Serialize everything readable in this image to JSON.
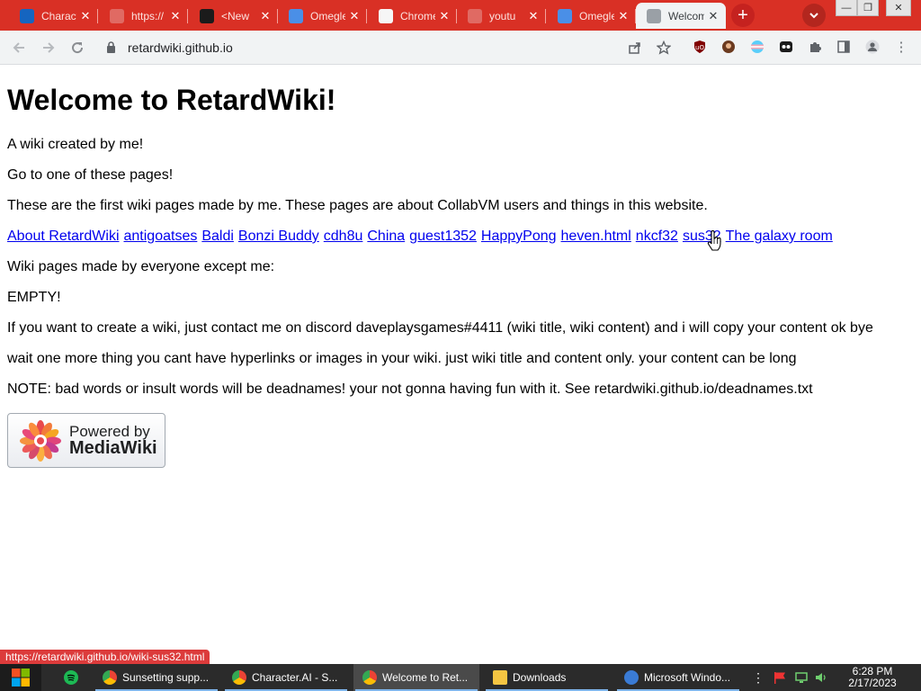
{
  "browser": {
    "tabs": [
      {
        "title": "Character.AI",
        "icon": "character-ai-icon",
        "color": "#1565c0"
      },
      {
        "title": "https://",
        "icon": "globe-icon",
        "color": "#e06a63"
      },
      {
        "title": "<New",
        "icon": "tumblr-icon",
        "color": "#1b1b1b"
      },
      {
        "title": "Omegle",
        "icon": "omegle-icon",
        "color": "#4a8fe7"
      },
      {
        "title": "Chrome",
        "icon": "chrome-dino-icon",
        "color": "#f6f6f6"
      },
      {
        "title": "youtu",
        "icon": "globe-icon",
        "color": "#e06a63"
      },
      {
        "title": "Omegle",
        "icon": "omegle-icon",
        "color": "#4a8fe7"
      },
      {
        "title": "Welcome",
        "icon": "globe-icon",
        "color": "#9aa0a6",
        "active": true
      }
    ],
    "new_tab": "+",
    "address": "retardwiki.github.io",
    "window_controls": [
      "—",
      "❐",
      "✕"
    ]
  },
  "page": {
    "title": "Welcome to RetardWiki!",
    "lines": [
      "A wiki created by me!",
      "Go to one of these pages!",
      "These are the first wiki pages made by me. These pages are about CollabVM users and things in this website."
    ],
    "links": [
      "About RetardWiki",
      "antigoatses",
      "Baldi",
      "Bonzi Buddy",
      "cdh8u",
      "China",
      "guest1352",
      "HappyPong",
      "heven.html",
      "nkcf32",
      "sus32",
      "The galaxy room"
    ],
    "after_links": [
      "Wiki pages made by everyone except me:",
      "EMPTY!",
      "If you want to create a wiki, just contact me on discord daveplaysgames#4411 (wiki title, wiki content) and i will copy your content ok bye",
      "wait one more thing you cant have hyperlinks or images in your wiki. just wiki title and content only. your content can be long",
      "NOTE: bad words or insult words will be deadnames! your not gonna having fun with it. See retardwiki.github.io/deadnames.txt"
    ],
    "badge": {
      "line1": "Powered by",
      "line2": "MediaWiki"
    }
  },
  "status_url": "https://retardwiki.github.io/wiki-sus32.html",
  "taskbar": {
    "apps": [
      {
        "label": "Sunsetting supp...",
        "icon": "chrome-icon"
      },
      {
        "label": "Character.AI - S...",
        "icon": "chrome-icon"
      },
      {
        "label": "Welcome to Ret...",
        "icon": "chrome-icon",
        "active": true
      },
      {
        "label": "Downloads",
        "icon": "folder-icon"
      },
      {
        "label": "Microsoft Windo...",
        "icon": "windows-installer-icon"
      }
    ],
    "time": "6:28 PM",
    "date": "2/17/2023"
  }
}
